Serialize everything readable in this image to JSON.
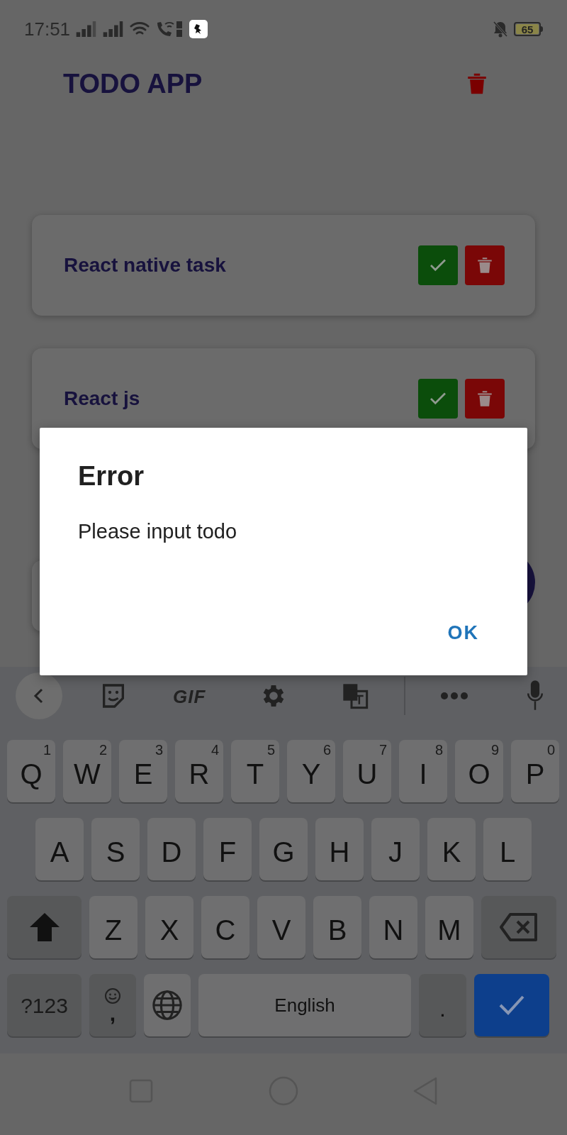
{
  "status_bar": {
    "time": "17:51",
    "battery": "65"
  },
  "app_bar": {
    "title": "TODO APP"
  },
  "todos": [
    {
      "text": "React native task"
    },
    {
      "text": "React js"
    }
  ],
  "dialog": {
    "title": "Error",
    "message": "Please input todo",
    "buttons": [
      "OK"
    ]
  },
  "keyboard": {
    "toolbar_label": "GIF",
    "number_row": [
      {
        "kind": "letter",
        "label": "Q",
        "hint": "1"
      },
      {
        "kind": "letter",
        "label": "W",
        "hint": "2"
      },
      {
        "kind": "letter",
        "label": "E",
        "hint": "3"
      },
      {
        "kind": "letter",
        "label": "R",
        "hint": "4"
      },
      {
        "kind": "letter",
        "label": "T",
        "hint": "5"
      },
      {
        "kind": "letter",
        "label": "Y",
        "hint": "6"
      },
      {
        "kind": "letter",
        "label": "U",
        "hint": "7"
      },
      {
        "kind": "letter",
        "label": "I",
        "hint": "8"
      },
      {
        "kind": "letter",
        "label": "O",
        "hint": "9"
      },
      {
        "kind": "letter",
        "label": "P",
        "hint": "0"
      }
    ],
    "home_row": [
      {
        "kind": "letter",
        "label": "A"
      },
      {
        "kind": "letter",
        "label": "S"
      },
      {
        "kind": "letter",
        "label": "D"
      },
      {
        "kind": "letter",
        "label": "F"
      },
      {
        "kind": "letter",
        "label": "G"
      },
      {
        "kind": "letter",
        "label": "H"
      },
      {
        "kind": "letter",
        "label": "J"
      },
      {
        "kind": "letter",
        "label": "K"
      },
      {
        "kind": "letter",
        "label": "L"
      }
    ],
    "shift_row": [
      {
        "kind": "shift"
      },
      {
        "kind": "letter",
        "label": "Z"
      },
      {
        "kind": "letter",
        "label": "X"
      },
      {
        "kind": "letter",
        "label": "C"
      },
      {
        "kind": "letter",
        "label": "V"
      },
      {
        "kind": "letter",
        "label": "B"
      },
      {
        "kind": "letter",
        "label": "N"
      },
      {
        "kind": "letter",
        "label": "M"
      },
      {
        "kind": "backspace"
      }
    ],
    "space_row": [
      {
        "kind": "symbols",
        "label": "?123"
      },
      {
        "kind": "emoji",
        "label": ","
      },
      {
        "kind": "globe"
      },
      {
        "kind": "space",
        "label": "English"
      },
      {
        "kind": "period",
        "label": "."
      },
      {
        "kind": "enter"
      }
    ]
  }
}
